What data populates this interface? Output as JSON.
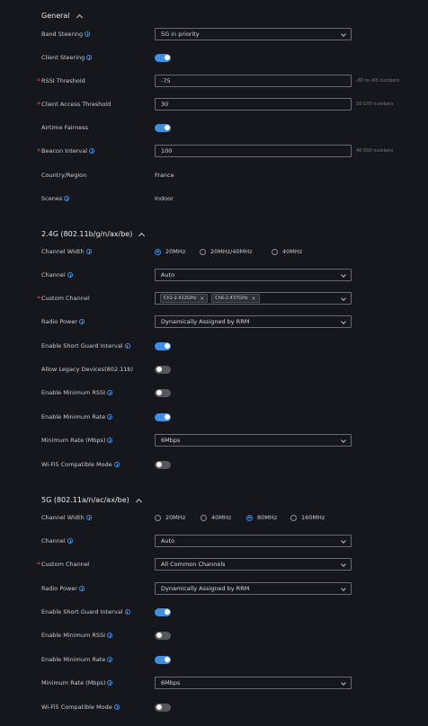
{
  "general": {
    "title": "General",
    "band_steering": {
      "label": "Band Steering",
      "value": "5G in priority"
    },
    "client_steering": {
      "label": "Client Steering",
      "on": true
    },
    "rssi_threshold": {
      "label": "RSSI Threshold",
      "value": "-75",
      "hint": "-80 to -65 numbers"
    },
    "client_access_threshold": {
      "label": "Client Access Threshold",
      "value": "30",
      "hint": "10-100 numbers"
    },
    "airtime_fairness": {
      "label": "Airtime Fairness",
      "on": true
    },
    "beacon_interval": {
      "label": "Beacon Interval",
      "value": "100",
      "hint": "40-500 numbers"
    },
    "country": {
      "label": "Country/Region",
      "value": "France"
    },
    "scenes": {
      "label": "Scenes",
      "value": "Indoor"
    }
  },
  "band24": {
    "title": "2.4G (802.11b/g/n/ax/be)",
    "channel_width": {
      "label": "Channel Width",
      "options": [
        "20MHz",
        "20MHz/40MHz",
        "40MHz"
      ],
      "selected": 0
    },
    "channel": {
      "label": "Channel",
      "value": "Auto"
    },
    "custom_channel": {
      "label": "Custom Channel",
      "tags": [
        "Ch1-2.412GHz",
        "Ch6-2.437GHz"
      ]
    },
    "radio_power": {
      "label": "Radio Power",
      "value": "Dynamically Assigned by RRM"
    },
    "short_guard": {
      "label": "Enable Short Guard Interval",
      "on": true
    },
    "legacy": {
      "label": "Allow Legacy Devices(802.11b)",
      "on": false
    },
    "min_rssi": {
      "label": "Enable Minimum RSSI",
      "on": false
    },
    "min_rate_enable": {
      "label": "Enable Minimum Rate",
      "on": true
    },
    "min_rate": {
      "label": "Minimum Rate (Mbps)",
      "value": "6Mbps"
    },
    "wifi5": {
      "label": "Wi-Fi5 Compatible Mode",
      "on": false
    }
  },
  "band5": {
    "title": "5G (802.11a/n/ac/ax/be)",
    "channel_width": {
      "label": "Channel Width",
      "options": [
        "20MHz",
        "40MHz",
        "80MHz",
        "160MHz"
      ],
      "selected": 2
    },
    "channel": {
      "label": "Channel",
      "value": "Auto"
    },
    "custom_channel": {
      "label": "Custom Channel",
      "value": "All Common Channels"
    },
    "radio_power": {
      "label": "Radio Power",
      "value": "Dynamically Assigned by RRM"
    },
    "short_guard": {
      "label": "Enable Short Guard Interval",
      "on": true
    },
    "min_rssi": {
      "label": "Enable Minimum RSSI",
      "on": false
    },
    "min_rate_enable": {
      "label": "Enable Minimum Rate",
      "on": true
    },
    "min_rate": {
      "label": "Minimum Rate (Mbps)",
      "value": "6Mbps"
    },
    "wifi5": {
      "label": "Wi-Fi5 Compatible Mode",
      "on": false
    }
  },
  "colors": {
    "accent": "#3d8ee6",
    "required": "#e0434a",
    "background": "#15171c"
  }
}
